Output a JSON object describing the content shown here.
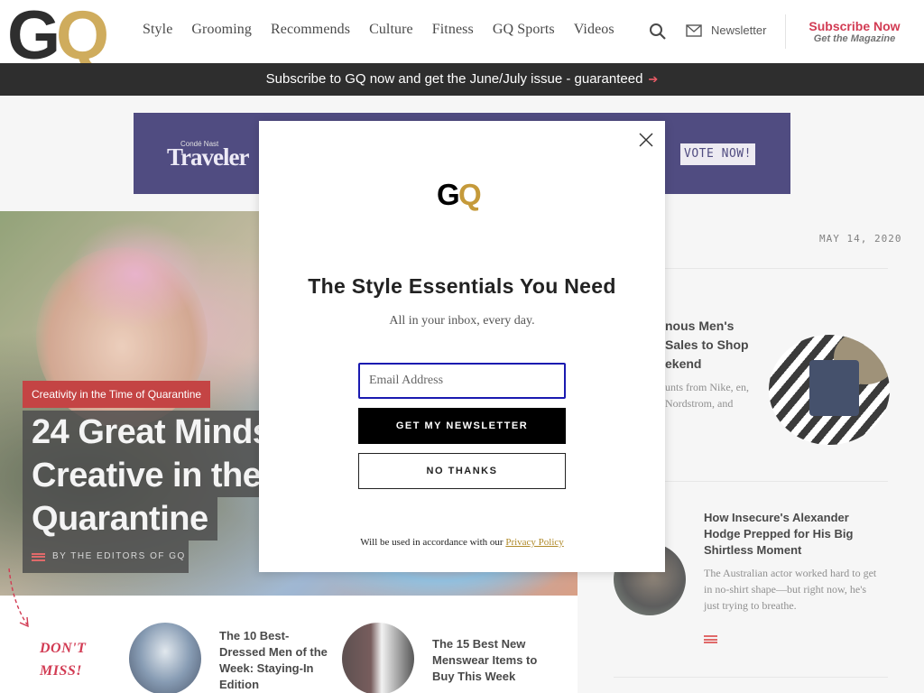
{
  "header": {
    "logo": "GQ",
    "nav": [
      "Style",
      "Grooming",
      "Recommends",
      "Culture",
      "Fitness",
      "GQ Sports",
      "Videos"
    ],
    "newsletter_label": "Newsletter",
    "subscribe_label": "Subscribe Now",
    "subscribe_sub": "Get the Magazine"
  },
  "promo": {
    "text": "Subscribe to GQ now and get the June/July issue - guaranteed",
    "arrow": "➔"
  },
  "ad": {
    "brand_small": "Condé Nast",
    "brand": "Traveler",
    "cta": "VOTE NOW!"
  },
  "hero": {
    "kicker": "Creativity in the Time of Quarantine",
    "headline_line1": "24 Great Minds",
    "headline_line2": "Creative in the",
    "headline_line3": "Quarantine",
    "byline": "BY THE EDITORS OF GQ"
  },
  "sidebar": {
    "date": "MAY 14, 2020",
    "story1": {
      "title": "nous Men's Sales to Shop ekend",
      "dek": "unts from Nike, en, Nordstrom, and"
    },
    "story2": {
      "title": "How Insecure's Alexander Hodge Prepped for His Big Shirtless Moment",
      "dek": "The Australian actor worked hard to get in no-shirt shape—but right now, he's just trying to breathe."
    }
  },
  "dont_miss": {
    "label_line1": "DON'T",
    "label_line2": "MISS!",
    "items": [
      {
        "title": "The 10 Best-Dressed Men of the Week: Staying-In Edition"
      },
      {
        "title": "The 15 Best New Menswear Items to Buy This Week"
      }
    ]
  },
  "modal": {
    "logo": "GQ",
    "title": "The Style Essentials You Need",
    "subtitle": "All in your inbox, every day.",
    "email_placeholder": "Email Address",
    "email_value": "",
    "primary_button": "GET MY NEWSLETTER",
    "secondary_button": "NO THANKS",
    "legal_prefix": "Will be used in accordance with our ",
    "legal_link": "Privacy Policy"
  },
  "colors": {
    "accent_red": "#c8102e",
    "gold": "#c59a3a",
    "ad_bg": "#2a2566",
    "input_border": "#1a1ab0"
  }
}
